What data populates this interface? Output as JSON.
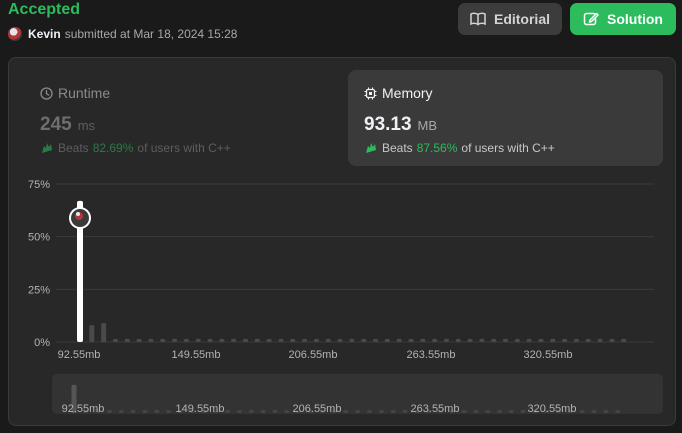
{
  "header": {
    "status": "Accepted",
    "user": "Kevin",
    "submitted_text": "submitted at Mar 18, 2024 15:28",
    "editorial_label": "Editorial",
    "solution_label": "Solution"
  },
  "runtime": {
    "title": "Runtime",
    "value": "245",
    "unit": "ms",
    "beats_label": "Beats",
    "beats_pct": "82.69%",
    "beats_suffix": "of users with C++"
  },
  "memory": {
    "title": "Memory",
    "value": "93.13",
    "unit": "MB",
    "beats_label": "Beats",
    "beats_pct": "87.56%",
    "beats_suffix": "of users with C++"
  },
  "chart_data": {
    "type": "bar",
    "x_ticks": [
      "92.55mb",
      "149.55mb",
      "206.55mb",
      "263.55mb",
      "320.55mb"
    ],
    "y_ticks": [
      "75%",
      "50%",
      "25%",
      "0%"
    ],
    "ylim": [
      0,
      75
    ],
    "values": [
      67,
      8,
      9,
      1.5,
      1.5,
      1.5,
      1.5,
      1.5,
      1.5,
      1.5,
      1.5,
      1.5,
      1.5,
      1.5,
      1.5,
      1.5,
      1.5,
      1.5,
      1.5,
      1.5,
      1.5,
      1.5,
      1.5,
      1.5,
      1.5,
      1.5,
      1.5,
      1.5,
      1.5,
      1.5,
      1.5,
      1.5,
      1.5,
      1.5,
      1.5,
      1.5,
      1.5,
      1.5,
      1.5,
      1.5,
      1.5,
      1.5,
      1.5,
      1.5,
      1.5,
      1.5,
      1.5
    ],
    "highlight_index": 0,
    "grid": true,
    "colors": {
      "highlight": "#ffffff",
      "bar": "#4a4a4a",
      "grid": "#3a3a3a"
    }
  }
}
